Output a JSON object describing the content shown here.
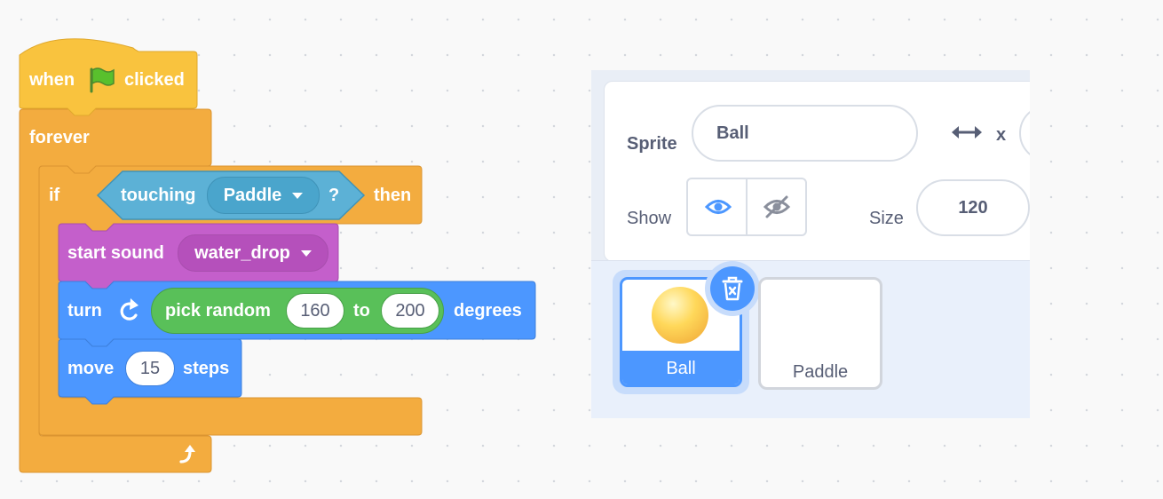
{
  "script": {
    "hat": {
      "when": "when",
      "clicked": "clicked"
    },
    "forever": {
      "label": "forever"
    },
    "if_block": {
      "if": "if",
      "then": "then",
      "condition": {
        "touching": "touching",
        "target": "Paddle",
        "question": "?"
      }
    },
    "start_sound": {
      "label": "start sound",
      "sound": "water_drop"
    },
    "turn": {
      "label": "turn",
      "pick_random": "pick random",
      "from": "160",
      "to_label": "to",
      "to": "200",
      "degrees": "degrees"
    },
    "move": {
      "label": "move",
      "steps_value": "15",
      "steps": "steps"
    }
  },
  "sprite_info": {
    "sprite_label": "Sprite",
    "sprite_name": "Ball",
    "x_label": "x",
    "show_label": "Show",
    "size_label": "Size",
    "size_value": "120"
  },
  "sprites": [
    {
      "name": "Ball",
      "selected": true
    },
    {
      "name": "Paddle",
      "selected": false
    }
  ],
  "colors": {
    "events": "#ffbf00",
    "control": "#ffab19",
    "sensing": "#5cb1d6",
    "sound": "#cf63cf",
    "motion": "#4c97ff",
    "operators": "#59c059",
    "selected": "#4c97ff"
  }
}
